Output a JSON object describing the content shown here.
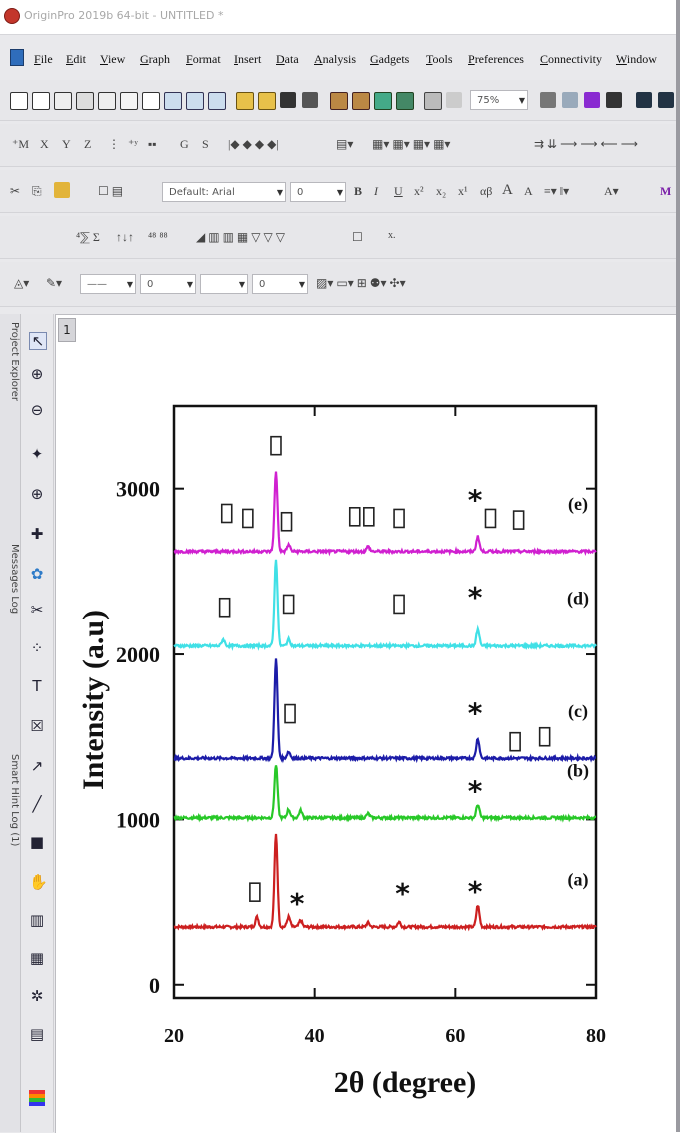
{
  "window": {
    "title": "OriginPro 2019b 64-bit - UNTITLED *"
  },
  "menu": {
    "items": [
      "File",
      "Edit",
      "View",
      "Graph",
      "Format",
      "Insert",
      "Data",
      "Analysis",
      "Gadgets",
      "Tools",
      "Preferences",
      "Connectivity",
      "Window"
    ]
  },
  "toolbar": {
    "zoom": "75%",
    "worksheet_letters": [
      "X",
      "Y",
      "Z",
      "G",
      "S"
    ],
    "font_combo": "Default: Arial",
    "font_size": "0",
    "format_buttons": [
      "B",
      "I",
      "U",
      "x²",
      "x₂",
      "x¹",
      "αβ",
      "A",
      "A"
    ],
    "line_width": "0",
    "symbol_size": "0"
  },
  "side_panels": [
    "Project Explorer",
    "Messages Log",
    "Smart Hint Log (1)"
  ],
  "graph": {
    "layer_number": "1"
  },
  "chart_data": {
    "type": "line",
    "xlabel": "2θ (degree)",
    "ylabel": "Intensity (a.u)",
    "xlim": [
      20,
      80
    ],
    "ylim": [
      -80,
      3500
    ],
    "xticks": [
      "20",
      "40",
      "60",
      "80"
    ],
    "yticks": [
      "0",
      "1000",
      "2000",
      "3000"
    ],
    "series": [
      {
        "label": "(a)",
        "color": "#cc2020",
        "baseline": 350,
        "peaks": [
          [
            31.8,
            60
          ],
          [
            34.5,
            560
          ],
          [
            36.3,
            60
          ],
          [
            38.0,
            40
          ],
          [
            47.6,
            25
          ],
          [
            52.0,
            30
          ],
          [
            63.2,
            130
          ]
        ],
        "markers": [
          {
            "x": 31.5,
            "y": 560,
            "symbol": "box"
          },
          {
            "x": 37.5,
            "y": 520,
            "symbol": "star"
          },
          {
            "x": 52.5,
            "y": 580,
            "symbol": "star"
          },
          {
            "x": 62.8,
            "y": 590,
            "symbol": "star"
          }
        ]
      },
      {
        "label": "(b)",
        "color": "#28c828",
        "baseline": 1010,
        "peaks": [
          [
            34.5,
            320
          ],
          [
            36.3,
            50
          ],
          [
            38.0,
            45
          ],
          [
            47.6,
            25
          ],
          [
            63.2,
            80
          ]
        ],
        "markers": [
          {
            "x": 62.8,
            "y": 1200,
            "symbol": "star"
          }
        ]
      },
      {
        "label": "(c)",
        "color": "#1c1ca8",
        "baseline": 1370,
        "peaks": [
          [
            34.5,
            600
          ],
          [
            36.3,
            40
          ],
          [
            63.2,
            120
          ]
        ],
        "markers": [
          {
            "x": 36.5,
            "y": 1640,
            "symbol": "box"
          },
          {
            "x": 62.8,
            "y": 1670,
            "symbol": "star"
          },
          {
            "x": 68.5,
            "y": 1470,
            "symbol": "box"
          },
          {
            "x": 72.7,
            "y": 1500,
            "symbol": "box"
          }
        ]
      },
      {
        "label": "(d)",
        "color": "#40e0e6",
        "baseline": 2050,
        "peaks": [
          [
            27.0,
            40
          ],
          [
            34.5,
            520
          ],
          [
            36.3,
            40
          ],
          [
            63.2,
            100
          ]
        ],
        "markers": [
          {
            "x": 27.2,
            "y": 2280,
            "symbol": "box"
          },
          {
            "x": 36.3,
            "y": 2300,
            "symbol": "box"
          },
          {
            "x": 52.0,
            "y": 2300,
            "symbol": "box"
          },
          {
            "x": 62.8,
            "y": 2370,
            "symbol": "star"
          }
        ]
      },
      {
        "label": "(e)",
        "color": "#d020d0",
        "baseline": 2620,
        "peaks": [
          [
            34.5,
            480
          ],
          [
            36.3,
            40
          ],
          [
            47.6,
            30
          ],
          [
            63.2,
            90
          ]
        ],
        "markers": [
          {
            "x": 34.5,
            "y": 3260,
            "symbol": "box"
          },
          {
            "x": 27.5,
            "y": 2850,
            "symbol": "box"
          },
          {
            "x": 30.5,
            "y": 2820,
            "symbol": "box"
          },
          {
            "x": 36.0,
            "y": 2800,
            "symbol": "box"
          },
          {
            "x": 45.7,
            "y": 2830,
            "symbol": "box"
          },
          {
            "x": 47.7,
            "y": 2830,
            "symbol": "box"
          },
          {
            "x": 52.0,
            "y": 2820,
            "symbol": "box"
          },
          {
            "x": 62.8,
            "y": 2960,
            "symbol": "star"
          },
          {
            "x": 65.0,
            "y": 2820,
            "symbol": "box"
          },
          {
            "x": 69.0,
            "y": 2810,
            "symbol": "box"
          }
        ]
      }
    ]
  }
}
